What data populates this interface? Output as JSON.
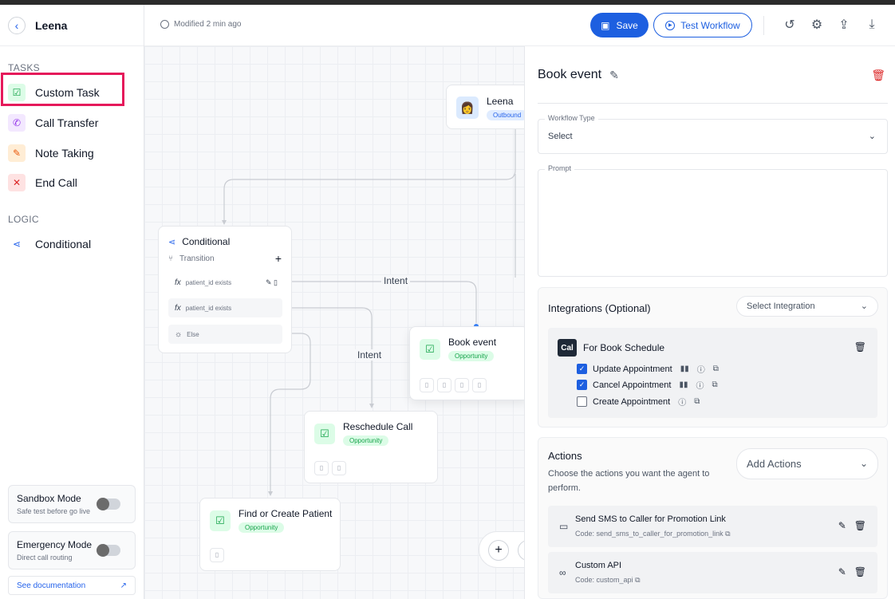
{
  "sidebar": {
    "title": "Leena",
    "tasks_heading": "TASKS",
    "logic_heading": "LOGIC",
    "tasks": [
      {
        "label": "Custom Task",
        "icon": "check-square-icon"
      },
      {
        "label": "Call Transfer",
        "icon": "phone-transfer-icon"
      },
      {
        "label": "Note Taking",
        "icon": "note-icon"
      },
      {
        "label": "End Call",
        "icon": "end-call-icon"
      }
    ],
    "logic": [
      {
        "label": "Conditional",
        "icon": "branch-icon"
      }
    ],
    "sandbox": {
      "title": "Sandbox Mode",
      "subtitle": "Safe test before go live"
    },
    "emergency": {
      "title": "Emergency Mode",
      "subtitle": "Direct call routing"
    },
    "doc_link": "See documentation"
  },
  "topbar": {
    "modified": "Modified 2 min ago",
    "save_label": "Save",
    "test_label": "Test Workflow"
  },
  "canvas": {
    "root": {
      "title": "Leena",
      "badge": "Outbound"
    },
    "conditional": {
      "title": "Conditional",
      "transition_label": "Transition",
      "rows": [
        "patient_id exists",
        "patient_id exists",
        "Else"
      ]
    },
    "edge_labels": [
      "Intent",
      "Intent"
    ],
    "book_event": {
      "title": "Book event",
      "badge": "Opportunity"
    },
    "reschedule": {
      "title": "Reschedule Call",
      "badge": "Opportunity"
    },
    "find_patient": {
      "title": "Find or Create Patient",
      "badge": "Opportunity"
    }
  },
  "panel": {
    "title": "Book event",
    "workflow_type_label": "Workflow Type",
    "workflow_type_value": "Select",
    "prompt_label": "Prompt",
    "integrations": {
      "title": "Integrations (Optional)",
      "select_placeholder": "Select Integration",
      "cal_logo": "Cal",
      "cal_title": "For Book Schedule",
      "options": [
        {
          "label": "Update Appointment",
          "checked": true
        },
        {
          "label": "Cancel Appointment",
          "checked": true
        },
        {
          "label": "Create Appointment",
          "checked": false
        }
      ]
    },
    "actions": {
      "title": "Actions",
      "description": "Choose the actions you want the agent to perform.",
      "add_label": "Add Actions",
      "items": [
        {
          "title": "Send SMS to Caller for Promotion Link",
          "code": "Code: send_sms_to_caller_for_promotion_link",
          "icon": "message-icon"
        },
        {
          "title": "Custom API",
          "code": "Code: custom_api",
          "icon": "api-icon"
        }
      ]
    }
  },
  "colors": {
    "accent": "#1d5fe0",
    "highlight": "#e5195a",
    "danger": "#dc2626",
    "success": "#16a34a"
  }
}
